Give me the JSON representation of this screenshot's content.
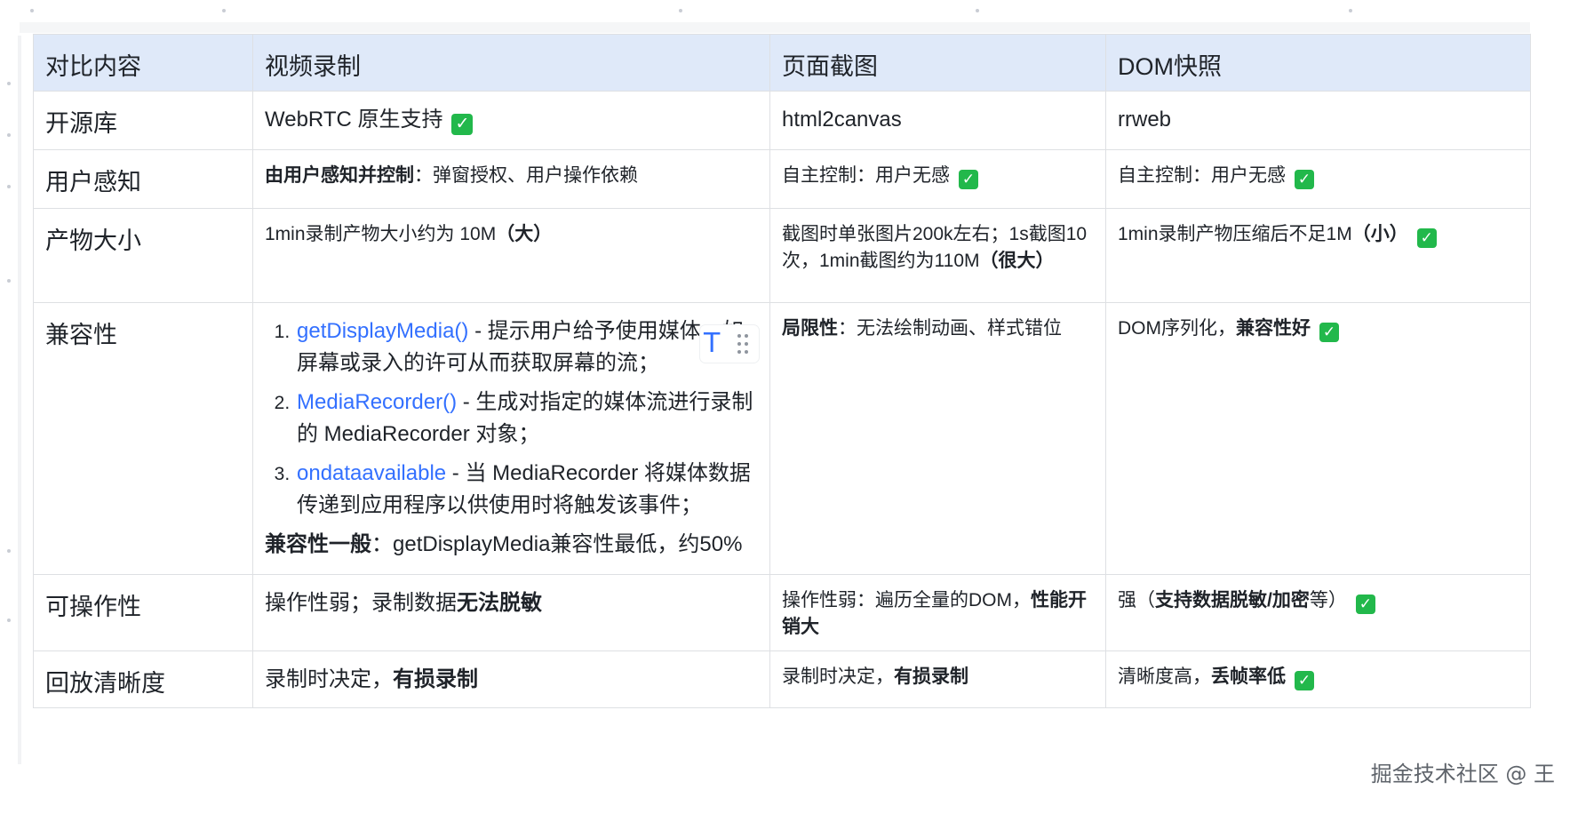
{
  "table": {
    "headers": [
      "对比内容",
      "视频录制",
      "页面截图",
      "DOM快照"
    ],
    "rows": {
      "library": {
        "label": "开源库",
        "video": "WebRTC 原生支持",
        "screenshot": "html2canvas",
        "dom": "rrweb"
      },
      "perception": {
        "label": "用户感知",
        "video_bold": "由用户感知并控制",
        "video_rest": "：弹窗授权、用户操作依赖",
        "screenshot": "自主控制：用户无感",
        "dom": "自主控制：用户无感"
      },
      "size": {
        "label": "产物大小",
        "video_text": "1min录制产物大小约为 10M",
        "video_bold": "（大）",
        "screenshot_text": "截图时单张图片200k左右；1s截图10次，1min截图约为110M",
        "screenshot_bold": "（很大）",
        "dom_text": "1min录制产物压缩后不足1M",
        "dom_bold": "（小）"
      },
      "compat": {
        "label": "兼容性",
        "video_items": [
          {
            "api": "getDisplayMedia()",
            "desc": " - 提示用户给予使用媒体，如屏幕或录入的许可从而获取屏幕的流；"
          },
          {
            "api": "MediaRecorder()",
            "desc": " - 生成对指定的媒体流进行录制的 MediaRecorder 对象；"
          },
          {
            "api": "ondataavailable",
            "desc": " - 当 MediaRecorder 将媒体数据传递到应用程序以供使用时将触发该事件；"
          }
        ],
        "video_summary_bold": "兼容性一般",
        "video_summary_rest": "：getDisplayMedia兼容性最低，约50%",
        "screenshot_bold": "局限性",
        "screenshot_rest": "：无法绘制动画、样式错位",
        "dom_text": "DOM序列化，",
        "dom_bold": "兼容性好"
      },
      "operability": {
        "label": "可操作性",
        "video_text": "操作性弱；录制数据",
        "video_bold": "无法脱敏",
        "screenshot_text": "操作性弱：遍历全量的DOM，",
        "screenshot_bold": "性能开销大",
        "dom_text_a": "强（",
        "dom_bold": "支持数据脱敏/加密",
        "dom_text_b": "等）"
      },
      "clarity": {
        "label": "回放清晰度",
        "video_text": "录制时决定，",
        "video_bold": "有损录制",
        "screenshot_text": "录制时决定，",
        "screenshot_bold": "有损录制",
        "dom_text": "清晰度高，",
        "dom_bold": "丢帧率低"
      }
    },
    "check_glyph": "✓"
  },
  "hover_tool": {
    "text_icon": "T",
    "icons": [
      "text-format-icon",
      "drag-handle-icon"
    ]
  },
  "watermark": "掘金技术社区 @ 王",
  "colors": {
    "header_bg": "#dfe9f9",
    "link": "#3370ff",
    "check": "#22b84b",
    "border": "#dee0e3"
  }
}
